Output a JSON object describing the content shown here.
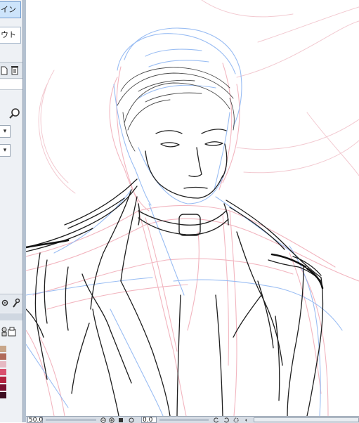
{
  "left_panel": {
    "tabs": [
      {
        "label": "イン",
        "selected": true
      },
      {
        "label": "ウト",
        "selected": false
      }
    ],
    "dropdown_arrow": "▾",
    "swatch_colors": [
      "#c8a68a",
      "#b06a5a",
      "#e6b9c3",
      "#d9506f",
      "#b3223f",
      "#7a1030",
      "#3c0d20"
    ]
  },
  "status_bar": {
    "zoom": "50.0",
    "angle": "0.0"
  }
}
